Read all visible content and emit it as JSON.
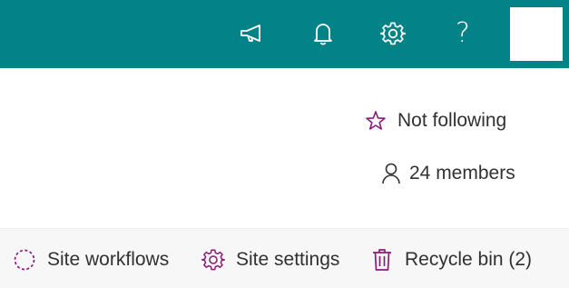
{
  "colors": {
    "header_bg": "#038387",
    "header_icon": "#ffffff",
    "accent_purple": "#8a1b7a",
    "text": "#323130",
    "command_bar_bg": "#f7f7f7"
  },
  "header": {
    "icons": [
      "megaphone-icon",
      "bell-icon",
      "gear-icon",
      "help-icon"
    ],
    "help_glyph": "?"
  },
  "site_info": {
    "follow_label": "Not following",
    "follow_icon": "star-outline-icon",
    "members_label": "24 members",
    "members_icon": "person-icon"
  },
  "command_bar": {
    "items": [
      {
        "label": "Site workflows",
        "icon": "workflow-icon"
      },
      {
        "label": "Site settings",
        "icon": "gear-icon"
      },
      {
        "label": "Recycle bin (2)",
        "icon": "trash-icon"
      }
    ]
  }
}
